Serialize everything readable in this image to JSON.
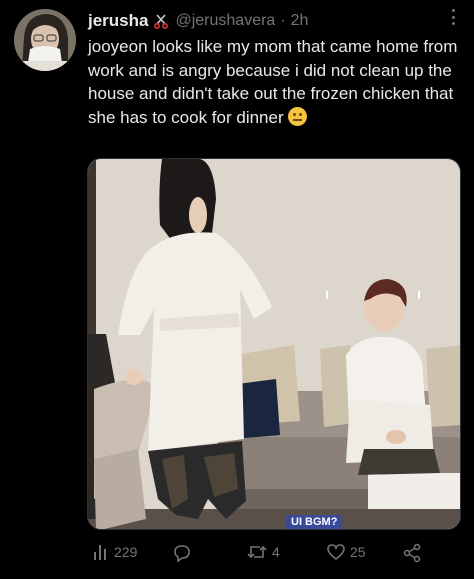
{
  "tweet": {
    "display_name": "jerusha",
    "handle": "@jerushavera",
    "separator": "·",
    "time": "2h",
    "text": "jooyeon looks like my mom that came home from work and is angry because i did not clean up the house and didn't take out the frozen chicken that she has to cook for dinner",
    "text_emoji": "neutral-face-emoji",
    "media": {
      "caption": "UI BGM?"
    }
  },
  "actions": {
    "views_count": "229",
    "replies_count": "",
    "retweets_count": "4",
    "likes_count": "25"
  },
  "icons": {
    "name_badge": "scissors-icon",
    "more": "more-icon",
    "views": "views-icon",
    "reply": "reply-icon",
    "retweet": "retweet-icon",
    "like": "heart-icon",
    "share": "share-icon"
  },
  "colors": {
    "background": "#000000",
    "text": "#e7e9ea",
    "secondary": "#71767b"
  }
}
